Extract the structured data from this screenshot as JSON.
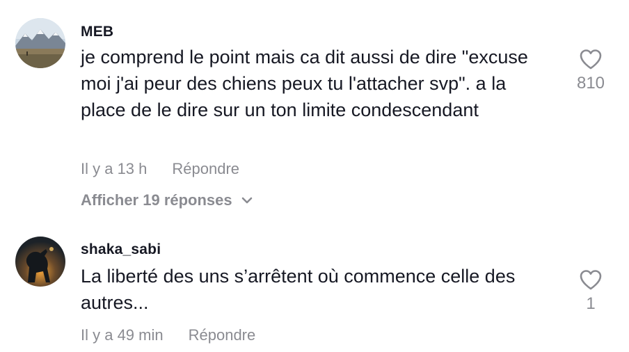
{
  "comments": [
    {
      "username": "MEB",
      "text": "je comprend le point mais ca dit aussi de dire \"excuse moi j'ai peur des chiens peux tu l'attacher svp\". a la place de le dire sur un ton limite condescendant",
      "time": "Il y a 13 h",
      "reply_label": "Répondre",
      "likes": "810",
      "view_replies": "Afficher 19 réponses"
    },
    {
      "username": "shaka_sabi",
      "text": "La liberté des uns s’arrêtent où commence celle des autres...",
      "time": "Il y a 49 min",
      "reply_label": "Répondre",
      "likes": "1"
    }
  ],
  "icons": {
    "like": "heart-outline-icon",
    "expand": "chevron-down-icon"
  },
  "colors": {
    "text": "#161823",
    "secondary": "#8a8b91",
    "background": "#ffffff"
  }
}
